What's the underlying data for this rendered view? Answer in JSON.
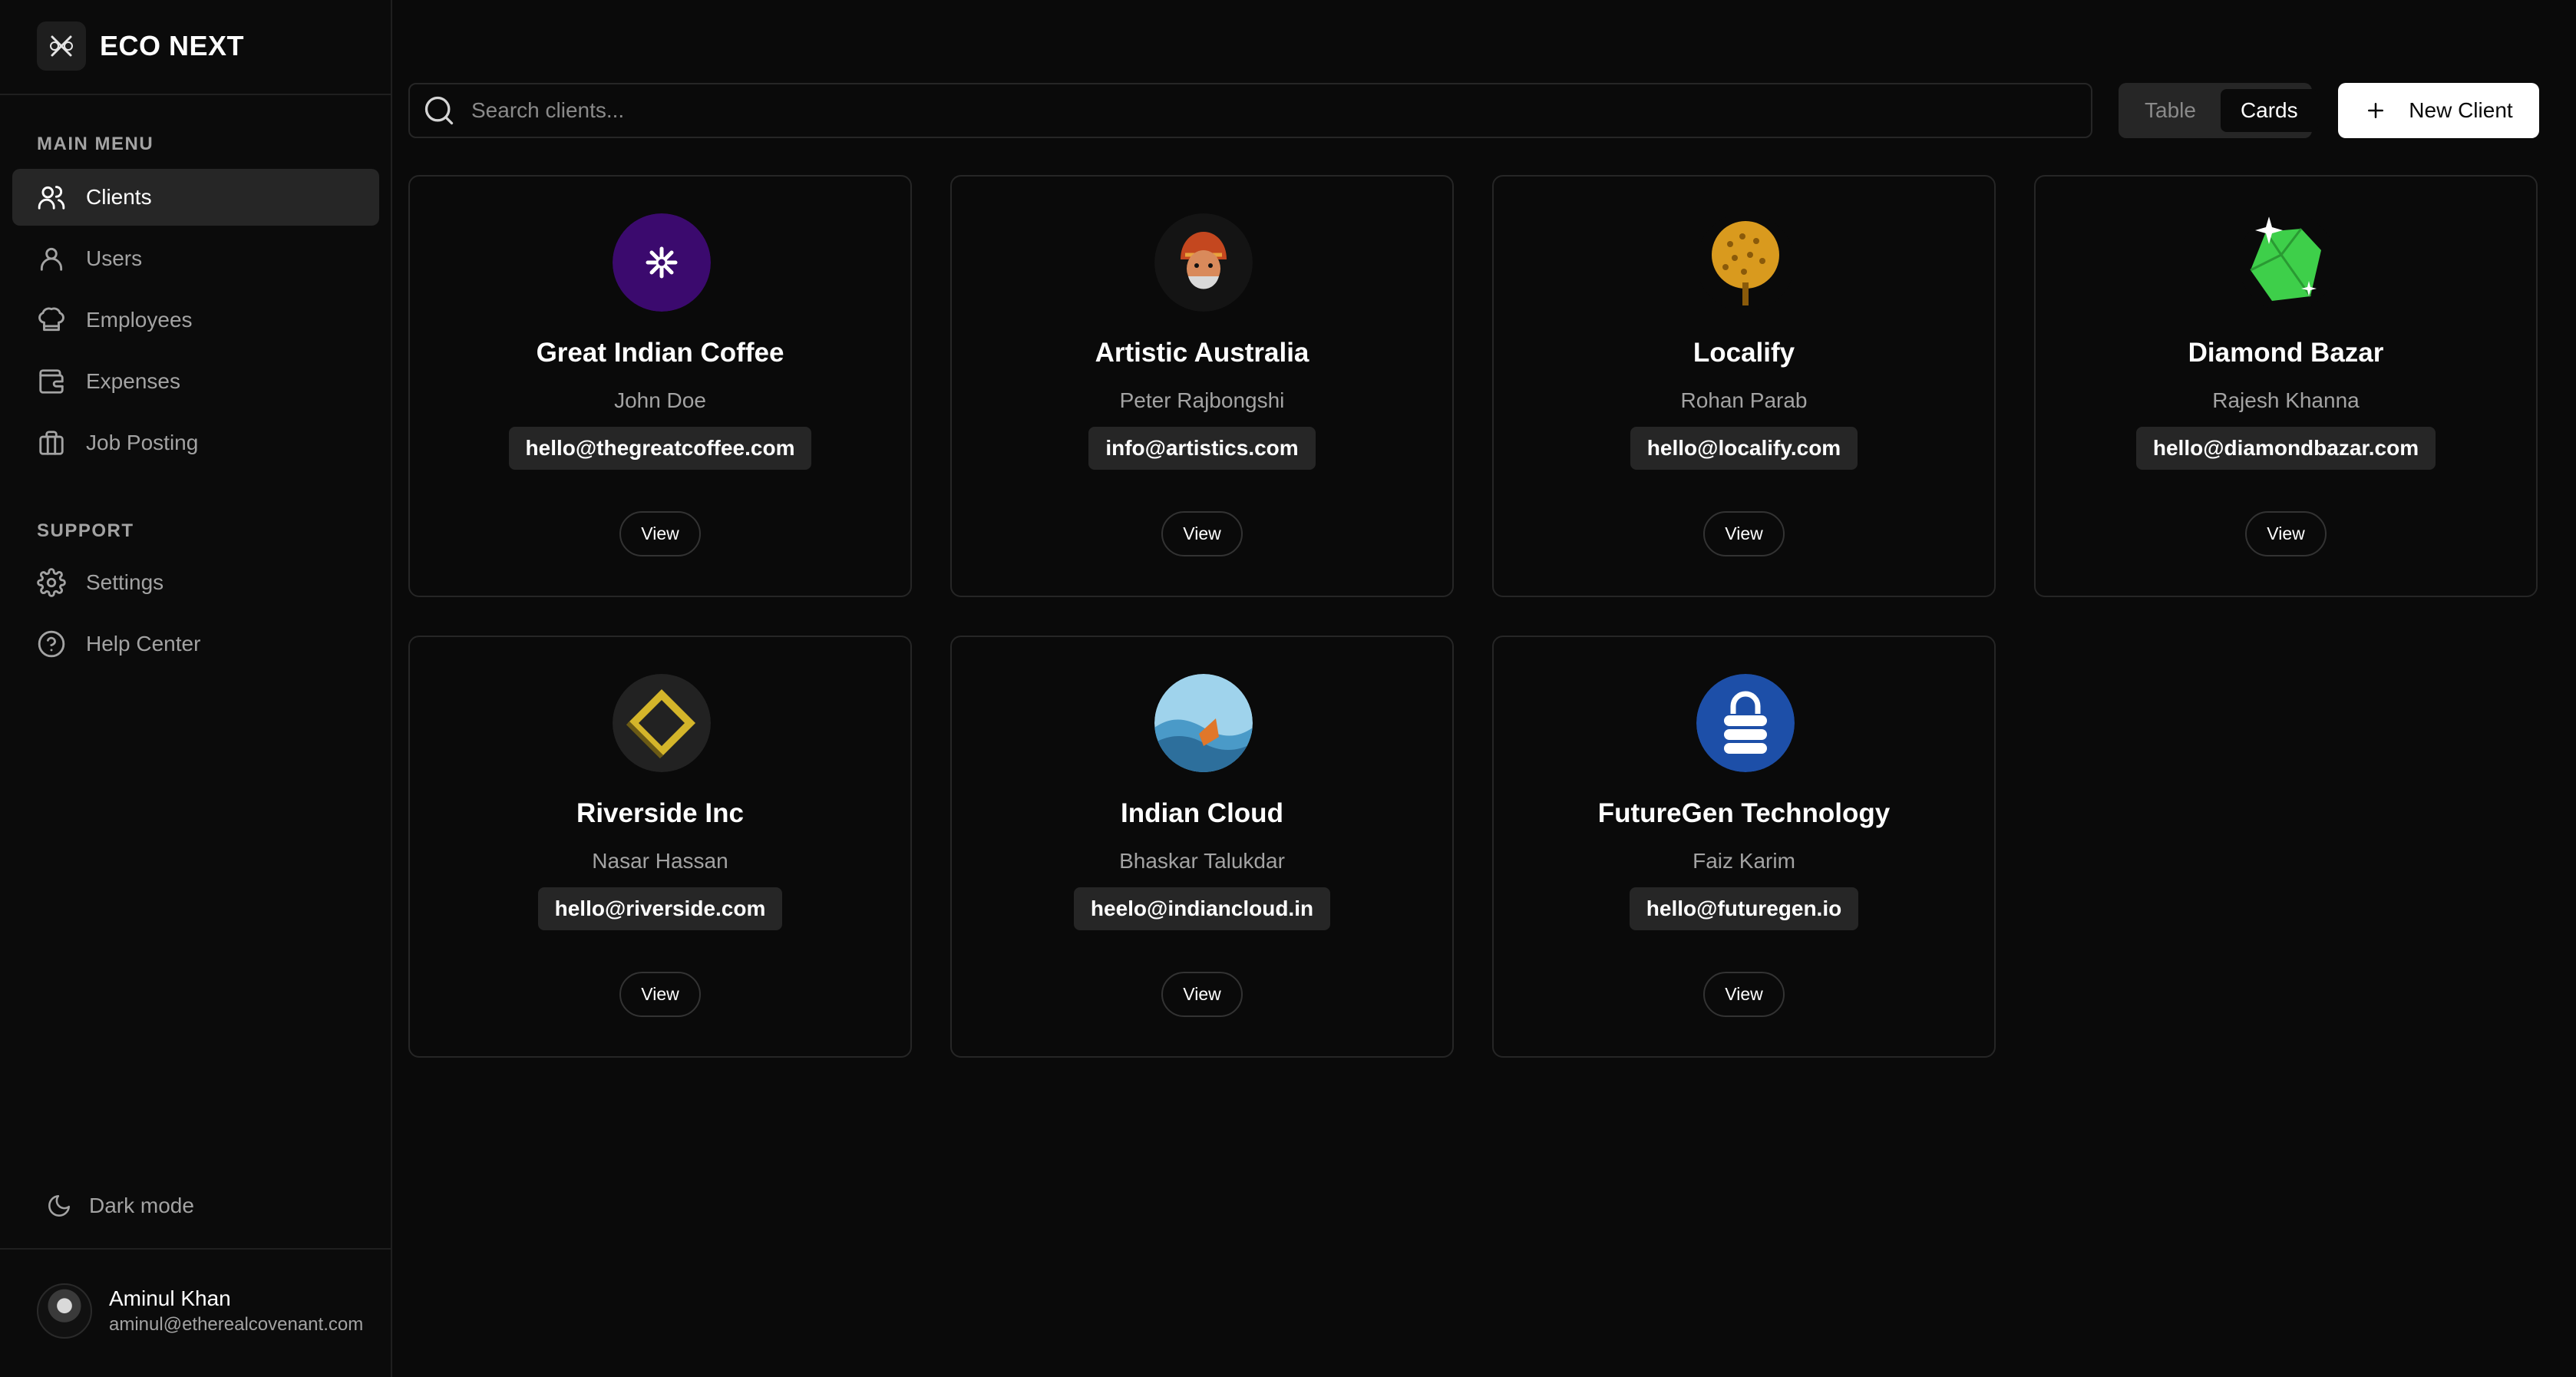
{
  "brand": {
    "name": "ECO NEXT"
  },
  "sidebar": {
    "main_menu_title": "MAIN MENU",
    "support_title": "SUPPORT",
    "items": [
      {
        "label": "Clients",
        "icon": "users-icon"
      },
      {
        "label": "Users",
        "icon": "user-icon"
      },
      {
        "label": "Employees",
        "icon": "chef-hat-icon"
      },
      {
        "label": "Expenses",
        "icon": "wallet-icon"
      },
      {
        "label": "Job Posting",
        "icon": "briefcase-icon"
      }
    ],
    "support_items": [
      {
        "label": "Settings",
        "icon": "gear-icon"
      },
      {
        "label": "Help Center",
        "icon": "help-circle-icon"
      }
    ],
    "dark_mode_label": "Dark mode",
    "user": {
      "name": "Aminul Khan",
      "email": "aminul@etherealcovenant.com"
    }
  },
  "search": {
    "placeholder": "Search clients..."
  },
  "view_toggle": {
    "table_label": "Table",
    "cards_label": "Cards",
    "selected": "Cards"
  },
  "new_client_label": "New Client",
  "clients": [
    {
      "name": "Great Indian Coffee",
      "contact": "John Doe",
      "email": "hello@thegreatcoffee.com",
      "view_label": "View",
      "avatar_color": "#3b0a6e"
    },
    {
      "name": "Artistic Australia",
      "contact": "Peter Rajbongshi",
      "email": "info@artistics.com",
      "view_label": "View",
      "avatar_color": "#1a1a1a"
    },
    {
      "name": "Localify",
      "contact": "Rohan Parab",
      "email": "hello@localify.com",
      "view_label": "View",
      "avatar_color": "#d99a1e"
    },
    {
      "name": "Diamond Bazar",
      "contact": "Rajesh Khanna",
      "email": "hello@diamondbazar.com",
      "view_label": "View",
      "avatar_color": "#3ecf4a"
    },
    {
      "name": "Riverside Inc",
      "contact": "Nasar Hassan",
      "email": "hello@riverside.com",
      "view_label": "View",
      "avatar_color": "#222222"
    },
    {
      "name": "Indian Cloud",
      "contact": "Bhaskar Talukdar",
      "email": "heelo@indiancloud.in",
      "view_label": "View",
      "avatar_color": "#4a9ac8"
    },
    {
      "name": "FutureGen Technology",
      "contact": "Faiz Karim",
      "email": "hello@futuregen.io",
      "view_label": "View",
      "avatar_color": "#1d4fa8"
    }
  ]
}
